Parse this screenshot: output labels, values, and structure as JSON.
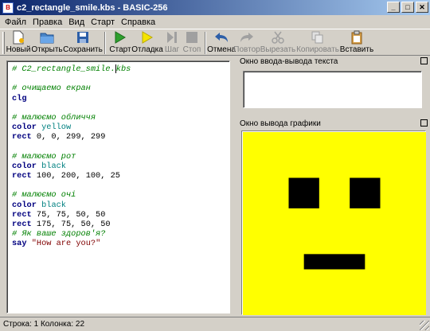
{
  "window": {
    "title": "c2_rectangle_smile.kbs - BASIC-256",
    "min_label": "_",
    "max_label": "□",
    "close_label": "✕"
  },
  "menu": [
    "Файл",
    "Правка",
    "Вид",
    "Старт",
    "Справка"
  ],
  "toolbar": {
    "new": "Новый",
    "open": "Открыть",
    "save": "Сохранить",
    "run": "Старт",
    "debug": "Отладка",
    "step": "Шаг",
    "stop": "Стоп",
    "undo": "Отмена",
    "redo": "Повтор",
    "cut": "Вырезать",
    "copy": "Копировать",
    "paste": "Вставить"
  },
  "editor": {
    "lines": [
      "# C2_rectangle_smile.kbs",
      "",
      "# очищаемо екран",
      "clg",
      "",
      "# малюємо обличчя",
      "color yellow",
      "rect 0, 0, 299, 299",
      "",
      "# малюємо рот",
      "color black",
      "rect 100, 200, 100, 25",
      "",
      "# малюємо очі",
      "color black",
      "rect 75, 75, 50, 50",
      "rect 175, 75, 50, 50",
      "# Як ваше здоров'я?",
      "say \"How are you?\""
    ]
  },
  "panels": {
    "text_io": "Окно ввода-вывода текста",
    "graphics": "Окно вывода графики"
  },
  "graphics": {
    "background": "#ffff00",
    "foreground": "#000000"
  },
  "status": {
    "text": "Строка: 1 Колонка: 22"
  }
}
